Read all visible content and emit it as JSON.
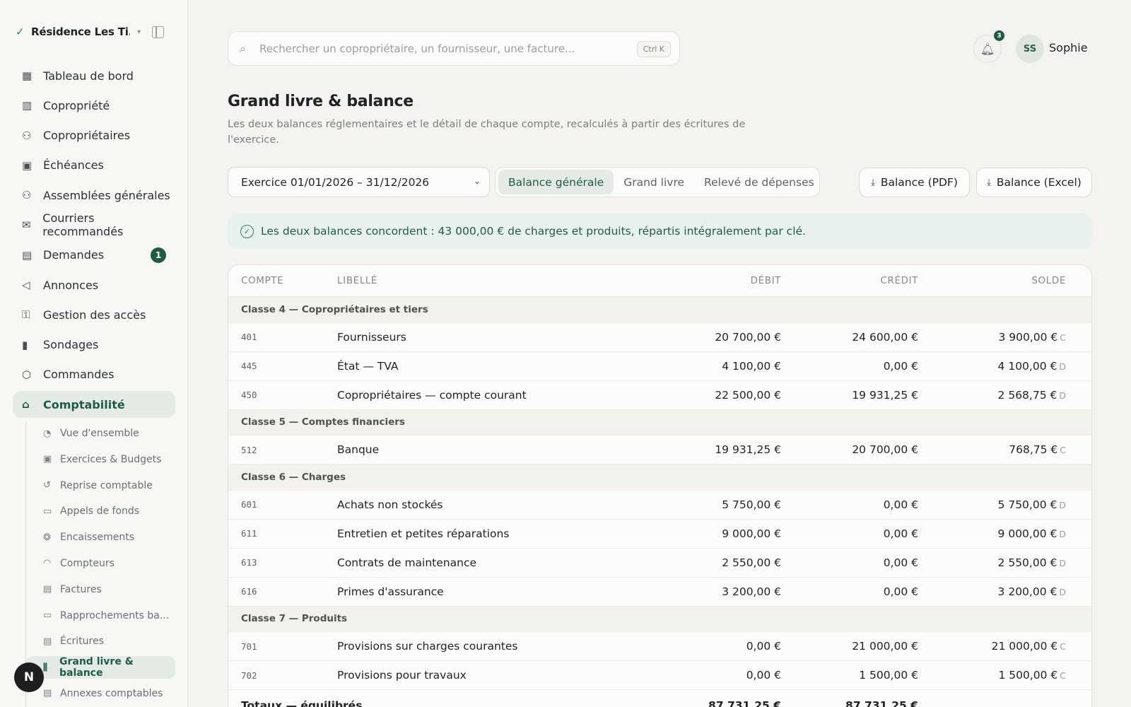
{
  "sidebar": {
    "org_name": "Résidence Les Ti...",
    "nav": [
      {
        "label": "Tableau de bord",
        "icon": "grid-icon"
      },
      {
        "label": "Copropriété",
        "icon": "building-icon"
      },
      {
        "label": "Copropriétaires",
        "icon": "users-icon"
      },
      {
        "label": "Échéances",
        "icon": "calendar-icon"
      },
      {
        "label": "Assemblées générales",
        "icon": "assembly-icon"
      },
      {
        "label": "Courriers recommandés",
        "icon": "mail-icon"
      },
      {
        "label": "Demandes",
        "icon": "message-icon",
        "badge": "1"
      },
      {
        "label": "Annonces",
        "icon": "megaphone-icon"
      },
      {
        "label": "Gestion des accès",
        "icon": "key-icon"
      },
      {
        "label": "Sondages",
        "icon": "chart-icon"
      },
      {
        "label": "Commandes",
        "icon": "package-icon"
      },
      {
        "label": "Comptabilité",
        "icon": "bank-icon",
        "active": true
      }
    ],
    "subnav": [
      {
        "label": "Vue d'ensemble",
        "icon": "pie-icon"
      },
      {
        "label": "Exercices & Budgets",
        "icon": "calendar-icon"
      },
      {
        "label": "Reprise comptable",
        "icon": "history-icon"
      },
      {
        "label": "Appels de fonds",
        "icon": "banknote-icon"
      },
      {
        "label": "Encaissements",
        "icon": "hand-coins-icon"
      },
      {
        "label": "Compteurs",
        "icon": "gauge-icon"
      },
      {
        "label": "Factures",
        "icon": "receipt-icon"
      },
      {
        "label": "Rapprochements ba...",
        "icon": "card-icon"
      },
      {
        "label": "Écritures",
        "icon": "book-icon"
      },
      {
        "label": "Grand livre & balance",
        "icon": "library-icon",
        "active": true
      },
      {
        "label": "Annexes comptables",
        "icon": "file-icon"
      }
    ],
    "logo_letter": "N"
  },
  "header": {
    "search_placeholder": "Rechercher un copropriétaire, un fournisseur, une facture...",
    "shortcut": "Ctrl K",
    "notif_count": "3",
    "user_initials": "SS",
    "user_name": "Sophie"
  },
  "page": {
    "title": "Grand livre & balance",
    "subtitle": "Les deux balances réglementaires et le détail de chaque compte, recalculés à partir des écritures de l'exercice."
  },
  "toolbar": {
    "exercise": "Exercice 01/01/2026 – 31/12/2026",
    "tabs": [
      "Balance générale",
      "Grand livre",
      "Relevé de dépenses"
    ],
    "active_tab": "Balance générale",
    "btn_pdf": "Balance (PDF)",
    "btn_xls": "Balance (Excel)"
  },
  "alert": "Les deux balances concordent : 43 000,00 € de charges et produits, répartis intégralement par clé.",
  "table": {
    "headers": {
      "code": "COMPTE",
      "label": "LIBELLÉ",
      "debit": "DÉBIT",
      "credit": "CRÉDIT",
      "balance": "SOLDE"
    },
    "groups": [
      {
        "title": "Classe 4 — Copropriétaires et tiers",
        "rows": [
          {
            "code": "401",
            "label": "Fournisseurs",
            "debit": "20 700,00 €",
            "credit": "24 600,00 €",
            "balance": "3 900,00 €",
            "side": "C"
          },
          {
            "code": "445",
            "label": "État — TVA",
            "debit": "4 100,00 €",
            "credit": "0,00 €",
            "balance": "4 100,00 €",
            "side": "D"
          },
          {
            "code": "450",
            "label": "Copropriétaires — compte courant",
            "debit": "22 500,00 €",
            "credit": "19 931,25 €",
            "balance": "2 568,75 €",
            "side": "D"
          }
        ]
      },
      {
        "title": "Classe 5 — Comptes financiers",
        "rows": [
          {
            "code": "512",
            "label": "Banque",
            "debit": "19 931,25 €",
            "credit": "20 700,00 €",
            "balance": "768,75 €",
            "side": "C"
          }
        ]
      },
      {
        "title": "Classe 6 — Charges",
        "rows": [
          {
            "code": "601",
            "label": "Achats non stockés",
            "debit": "5 750,00 €",
            "credit": "0,00 €",
            "balance": "5 750,00 €",
            "side": "D"
          },
          {
            "code": "611",
            "label": "Entretien et petites réparations",
            "debit": "9 000,00 €",
            "credit": "0,00 €",
            "balance": "9 000,00 €",
            "side": "D"
          },
          {
            "code": "613",
            "label": "Contrats de maintenance",
            "debit": "2 550,00 €",
            "credit": "0,00 €",
            "balance": "2 550,00 €",
            "side": "D"
          },
          {
            "code": "616",
            "label": "Primes d'assurance",
            "debit": "3 200,00 €",
            "credit": "0,00 €",
            "balance": "3 200,00 €",
            "side": "D"
          }
        ]
      },
      {
        "title": "Classe 7 — Produits",
        "rows": [
          {
            "code": "701",
            "label": "Provisions sur charges courantes",
            "debit": "0,00 €",
            "credit": "21 000,00 €",
            "balance": "21 000,00 €",
            "side": "C"
          },
          {
            "code": "702",
            "label": "Provisions pour travaux",
            "debit": "0,00 €",
            "credit": "1 500,00 €",
            "balance": "1 500,00 €",
            "side": "C"
          }
        ]
      }
    ],
    "totals": {
      "label": "Totaux — équilibrés",
      "debit": "87 731,25 €",
      "credit": "87 731,25 €"
    }
  }
}
